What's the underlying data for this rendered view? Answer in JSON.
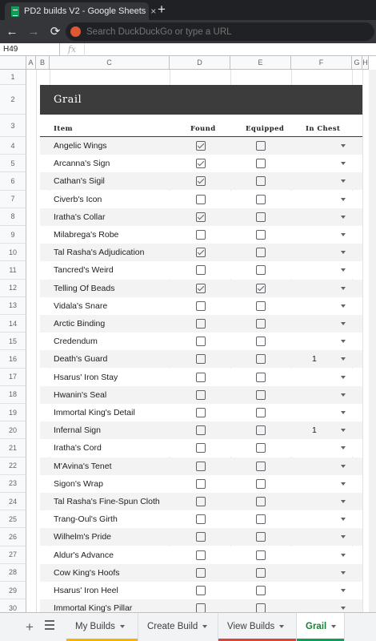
{
  "browser": {
    "tab_title": "PD2 builds V2 - Google Sheets",
    "tab_close": "×",
    "new_tab": "+",
    "back": "←",
    "forward": "→",
    "reload": "⟳",
    "omnibox_placeholder": "Search DuckDuckGo or type a URL"
  },
  "formula_bar": {
    "cell_ref": "H49",
    "fx": "fx"
  },
  "columns": [
    "A",
    "B",
    "C",
    "D",
    "E",
    "F",
    "G",
    "H"
  ],
  "sheet": {
    "title": "Grail",
    "headers": {
      "item": "Item",
      "found": "Found",
      "equipped": "Equipped",
      "in_chest": "In Chest"
    },
    "rows": [
      {
        "row": "4",
        "item": "Angelic Wings",
        "found": true,
        "equipped": false,
        "chest": ""
      },
      {
        "row": "5",
        "item": "Arcanna's Sign",
        "found": true,
        "equipped": false,
        "chest": ""
      },
      {
        "row": "6",
        "item": "Cathan's Sigil",
        "found": true,
        "equipped": false,
        "chest": ""
      },
      {
        "row": "7",
        "item": "Civerb's Icon",
        "found": false,
        "equipped": false,
        "chest": ""
      },
      {
        "row": "8",
        "item": "Iratha's Collar",
        "found": true,
        "equipped": false,
        "chest": ""
      },
      {
        "row": "9",
        "item": "Milabrega's Robe",
        "found": false,
        "equipped": false,
        "chest": ""
      },
      {
        "row": "10",
        "item": "Tal Rasha's Adjudication",
        "found": true,
        "equipped": false,
        "chest": ""
      },
      {
        "row": "11",
        "item": "Tancred's Weird",
        "found": false,
        "equipped": false,
        "chest": ""
      },
      {
        "row": "12",
        "item": "Telling Of Beads",
        "found": true,
        "equipped": true,
        "chest": ""
      },
      {
        "row": "13",
        "item": "Vidala's Snare",
        "found": false,
        "equipped": false,
        "chest": ""
      },
      {
        "row": "14",
        "item": "Arctic Binding",
        "found": false,
        "equipped": false,
        "chest": ""
      },
      {
        "row": "15",
        "item": "Credendum",
        "found": false,
        "equipped": false,
        "chest": ""
      },
      {
        "row": "16",
        "item": "Death's Guard",
        "found": false,
        "equipped": false,
        "chest": "1"
      },
      {
        "row": "17",
        "item": "Hsarus' Iron Stay",
        "found": false,
        "equipped": false,
        "chest": ""
      },
      {
        "row": "18",
        "item": "Hwanin's Seal",
        "found": false,
        "equipped": false,
        "chest": ""
      },
      {
        "row": "19",
        "item": "Immortal King's Detail",
        "found": false,
        "equipped": false,
        "chest": ""
      },
      {
        "row": "20",
        "item": "Infernal Sign",
        "found": false,
        "equipped": false,
        "chest": "1"
      },
      {
        "row": "21",
        "item": "Iratha's Cord",
        "found": false,
        "equipped": false,
        "chest": ""
      },
      {
        "row": "22",
        "item": "M'Avina's Tenet",
        "found": false,
        "equipped": false,
        "chest": ""
      },
      {
        "row": "23",
        "item": "Sigon's Wrap",
        "found": false,
        "equipped": false,
        "chest": ""
      },
      {
        "row": "24",
        "item": "Tal Rasha's Fine-Spun Cloth",
        "found": false,
        "equipped": false,
        "chest": ""
      },
      {
        "row": "25",
        "item": "Trang-Oul's Girth",
        "found": false,
        "equipped": false,
        "chest": ""
      },
      {
        "row": "26",
        "item": "Wilhelm's Pride",
        "found": false,
        "equipped": false,
        "chest": ""
      },
      {
        "row": "27",
        "item": "Aldur's Advance",
        "found": false,
        "equipped": false,
        "chest": ""
      },
      {
        "row": "28",
        "item": "Cow King's Hoofs",
        "found": false,
        "equipped": false,
        "chest": ""
      },
      {
        "row": "29",
        "item": "Hsarus' Iron Heel",
        "found": false,
        "equipped": false,
        "chest": ""
      },
      {
        "row": "30",
        "item": "Immortal King's Pillar",
        "found": false,
        "equipped": false,
        "chest": ""
      }
    ]
  },
  "sheet_tabs": {
    "add": "+",
    "tabs": [
      {
        "label": "My Builds",
        "color": "#f4b400",
        "active": false
      },
      {
        "label": "Create Build",
        "color": "",
        "active": false
      },
      {
        "label": "View Builds",
        "color": "#db4437",
        "active": false
      },
      {
        "label": "Grail",
        "color": "#0f9d58",
        "active": true
      }
    ]
  }
}
